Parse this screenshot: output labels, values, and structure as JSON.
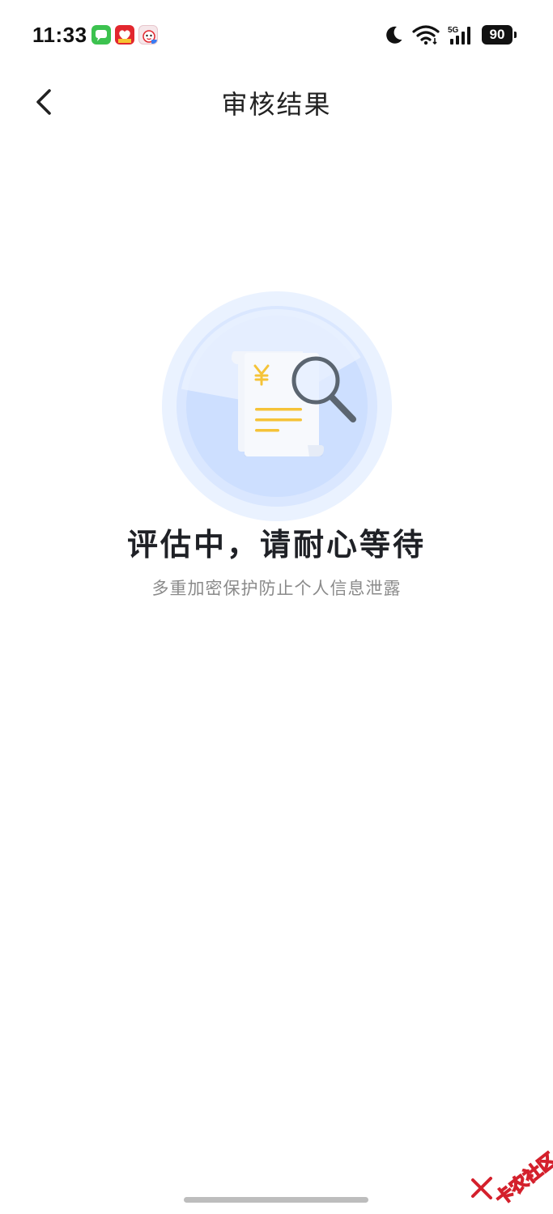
{
  "status_bar": {
    "time": "11:33",
    "notification_icons": [
      "messages-app-icon",
      "red-app-icon",
      "pink-app-icon"
    ],
    "network": "5G",
    "battery": "90"
  },
  "nav": {
    "title": "审核结果"
  },
  "main": {
    "heading": "评估中，请耐心等待",
    "subtext": "多重加密保护防止个人信息泄露"
  },
  "watermark": {
    "text": "卡农社区"
  },
  "colors": {
    "accent_yellow": "#f5c338",
    "circle_blue": "#c9dcff",
    "heading": "#1f2126",
    "subtext": "#8a8a8a"
  }
}
